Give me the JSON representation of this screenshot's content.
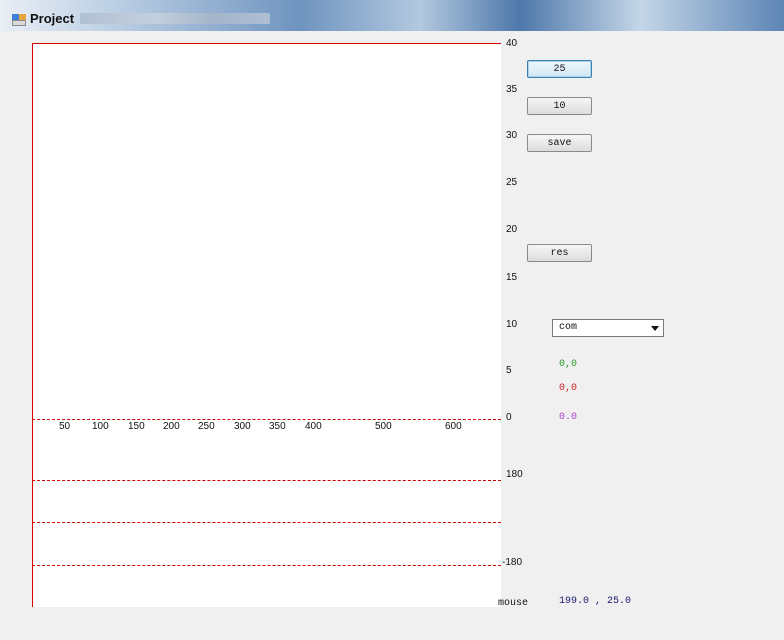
{
  "window": {
    "title": "Project"
  },
  "colors": {
    "frame": "#d40000",
    "readout_green": "#2a9a2a",
    "readout_red": "#cc2222",
    "readout_purple": "#b040d0",
    "mouse_value": "#1a1a6e"
  },
  "plot": {
    "x_ticks": [
      "50",
      "100",
      "150",
      "200",
      "250",
      "300",
      "350",
      "400",
      "500",
      "600"
    ],
    "y_ticks_top": [
      "40",
      "35",
      "30",
      "25",
      "20",
      "15",
      "10",
      "5",
      "0"
    ],
    "y_ticks_bottom": [
      "180",
      "-180"
    ]
  },
  "buttons": {
    "b25": "25",
    "b10": "10",
    "save": "save",
    "res": "res"
  },
  "combo": {
    "value": "com",
    "icon": "chevron-down-icon"
  },
  "readouts": {
    "green": "0,0",
    "red": "0,0",
    "purple": "0.0"
  },
  "mouse": {
    "label": "mouse",
    "value": "199.0 , 25.0"
  }
}
